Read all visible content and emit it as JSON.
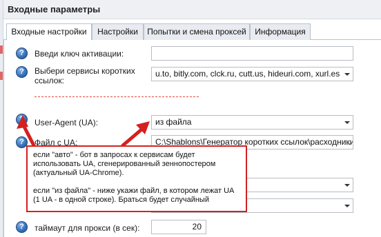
{
  "window": {
    "title": "Входные параметры"
  },
  "tabs": [
    {
      "label": "Входные настройки",
      "active": true
    },
    {
      "label": "Настройки",
      "active": false
    },
    {
      "label": "Попытки и смена проксей",
      "active": false
    },
    {
      "label": "Информация",
      "active": false
    }
  ],
  "form": {
    "activation_key": {
      "label": "Введи ключ активации:",
      "value": ""
    },
    "short_link_services": {
      "label_line1": "Выбери сервисы коротких",
      "label_line2": "ссылок:",
      "value": "u.to, bitly.com, clck.ru, cutt.us, hideuri.com, xurl.es"
    },
    "user_agent": {
      "label": "User-Agent (UA):",
      "value": "из файла"
    },
    "ua_file": {
      "label": "Файл с UA:",
      "value": "C:\\Shablons\\Генератор коротких ссылок\\расходники"
    },
    "proxy_timeout": {
      "label": "таймаут для прокси (в сек):",
      "value": "20"
    }
  },
  "tooltip": {
    "paragraph1": "если \"авто\" - бот в запросах к сервисам будет использовать UA, сгенерированный зеннопостером (актуальный UA-Chrome).",
    "paragraph2": "если \"из файла\" - ниже укажи файл, в котором лежат UA (1 UA - в одной строке). Браться будет случайный"
  },
  "icons": {
    "help": "question-icon",
    "help_glyph": "?",
    "dropdown": "chevron-down-icon",
    "browse": "ellipsis-icon",
    "browse_glyph": "..."
  },
  "colors": {
    "annotation_red": "#d42020",
    "help_blue": "#3570b8"
  }
}
